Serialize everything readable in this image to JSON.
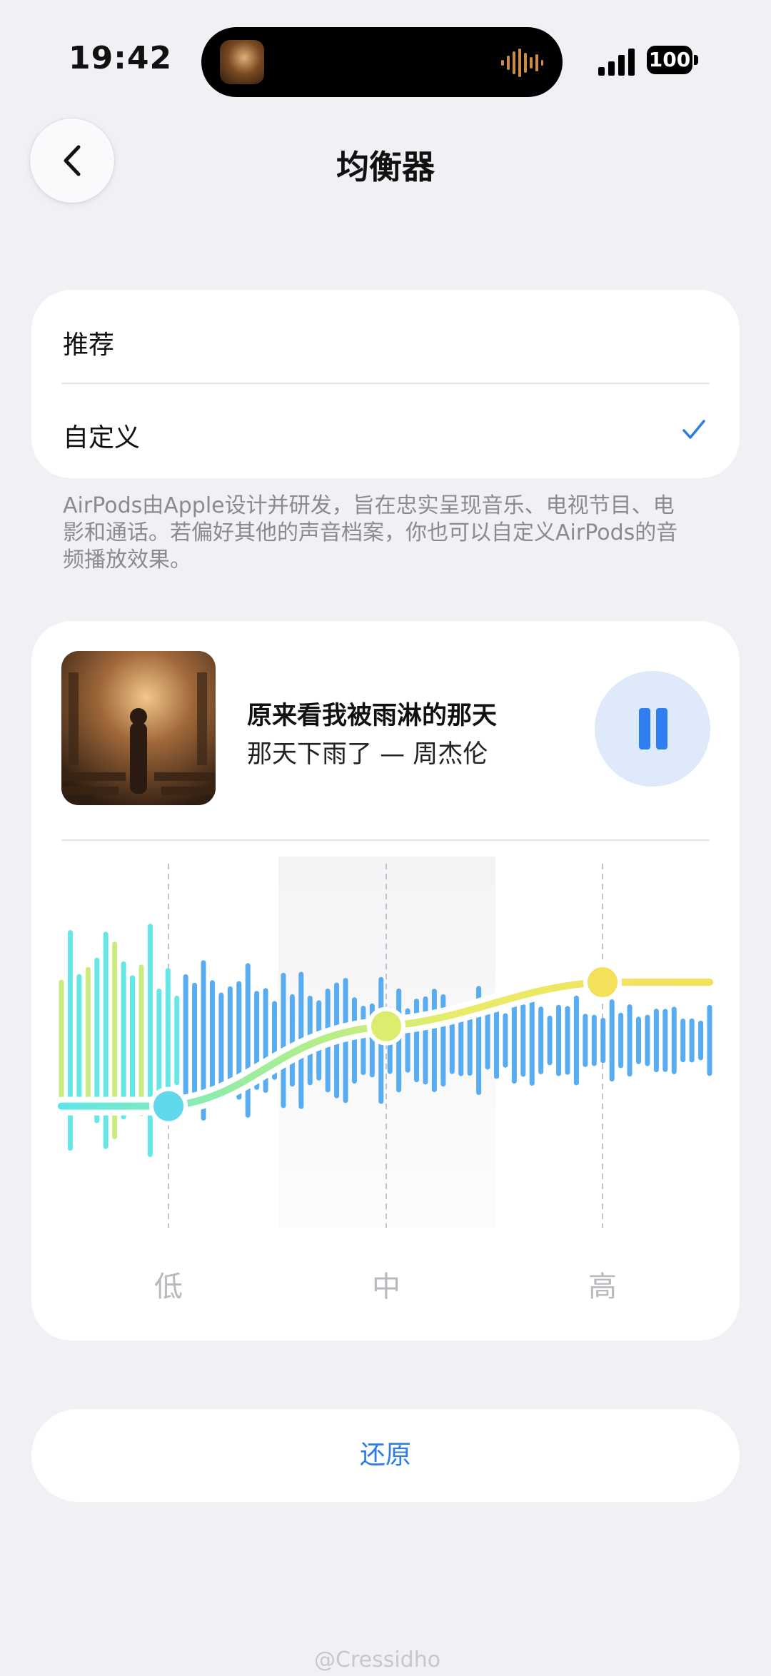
{
  "status_bar": {
    "time": "19:42",
    "battery": "100",
    "signal_icon": "signal-bars-icon"
  },
  "nav": {
    "back_icon": "chevron-left-icon",
    "title": "均衡器"
  },
  "mode_options": {
    "items": [
      {
        "label": "推荐",
        "selected": false
      },
      {
        "label": "自定义",
        "selected": true
      }
    ],
    "check_icon": "checkmark-icon"
  },
  "description": "AirPods由Apple设计并研发，旨在忠实呈现音乐、电视节目、电影和通话。若偏好其他的声音档案，你也可以自定义AirPods的音频播放效果。",
  "now_playing": {
    "song_title": "原来看我被雨淋的那天",
    "subtitle": "那天下雨了 — 周杰伦",
    "control_icon": "pause-icon"
  },
  "equalizer": {
    "bands": [
      {
        "label": "低",
        "level": 0.18
      },
      {
        "label": "中",
        "level": 0.58
      },
      {
        "label": "高",
        "level": 0.8
      }
    ],
    "highlighted_band": "中"
  },
  "reset": {
    "label": "还原"
  },
  "watermark": "@Cressidho",
  "colors": {
    "accent": "#2b7ce8",
    "wave_blue": "#4fa8f0",
    "wave_cyan": "#5ee6e6",
    "curve_yellow": "#f5e05a"
  }
}
